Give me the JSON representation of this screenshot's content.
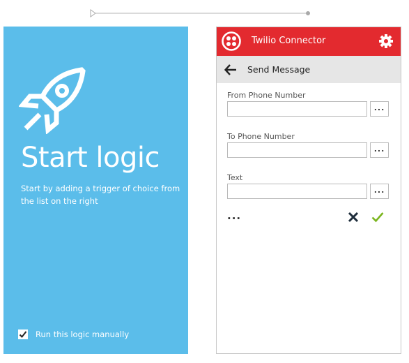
{
  "start": {
    "title": "Start logic",
    "description": "Start by adding a trigger of choice from the list on the right",
    "manual_label": "Run this logic manually",
    "manual_checked": true
  },
  "connector": {
    "title": "Twilio Connector",
    "action_title": "Send Message",
    "fields": [
      {
        "label": "From Phone Number",
        "value": "",
        "button": "..."
      },
      {
        "label": "To Phone Number",
        "value": "",
        "button": "..."
      },
      {
        "label": "Text",
        "value": "",
        "button": "..."
      }
    ],
    "more_label": "...",
    "icons": [
      "twilio-logo",
      "gear-icon",
      "back-arrow-icon",
      "cancel-icon",
      "checkmark-icon"
    ]
  },
  "colors": {
    "panel_blue": "#5bbdea",
    "header_red": "#e32a2f",
    "action_bar": "#e6e6e6",
    "confirm_green": "#7ab51d",
    "cancel_dark": "#1e2d3b"
  }
}
